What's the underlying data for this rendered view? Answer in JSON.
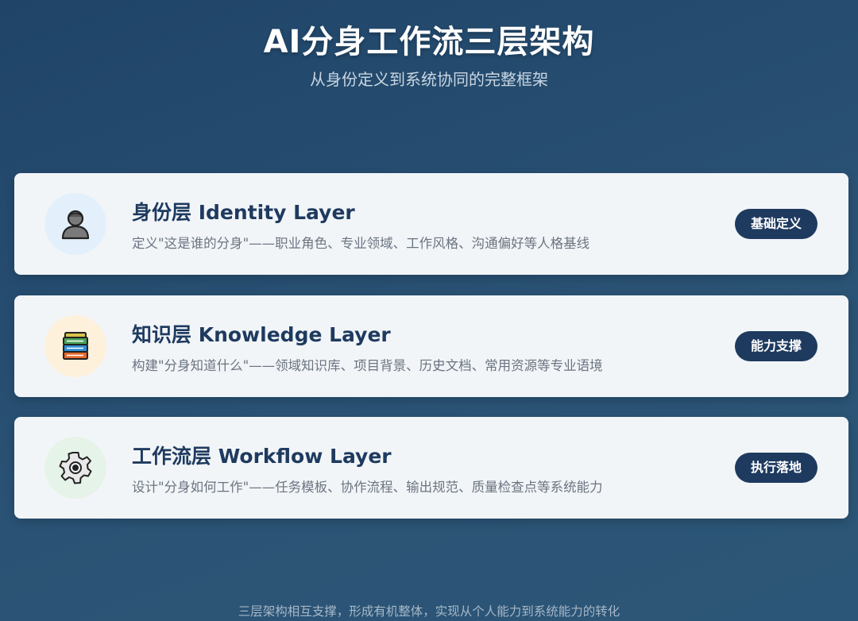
{
  "header": {
    "title": "AI分身工作流三层架构",
    "subtitle": "从身份定义到系统协同的完整框架"
  },
  "layers": [
    {
      "title": "身份层 Identity Layer",
      "description": "定义\"这是谁的分身\"——职业角色、专业领域、工作风格、沟通偏好等人格基线",
      "badge": "基础定义",
      "icon": "person-icon",
      "icon_bg": "#e3f0fb"
    },
    {
      "title": "知识层 Knowledge Layer",
      "description": "构建\"分身知道什么\"——领域知识库、项目背景、历史文档、常用资源等专业语境",
      "badge": "能力支撑",
      "icon": "books-icon",
      "icon_bg": "#fdf1dc"
    },
    {
      "title": "工作流层 Workflow Layer",
      "description": "设计\"分身如何工作\"——任务模板、协作流程、输出规范、质量检查点等系统能力",
      "badge": "执行落地",
      "icon": "gear-icon",
      "icon_bg": "#e6f3e8"
    }
  ],
  "footer": {
    "text": "三层架构相互支撑，形成有机整体，实现从个人能力到系统能力的转化"
  },
  "colors": {
    "accent": "#1e3a5f",
    "card_bg": "#f2f5f8",
    "background": "#24496d"
  }
}
